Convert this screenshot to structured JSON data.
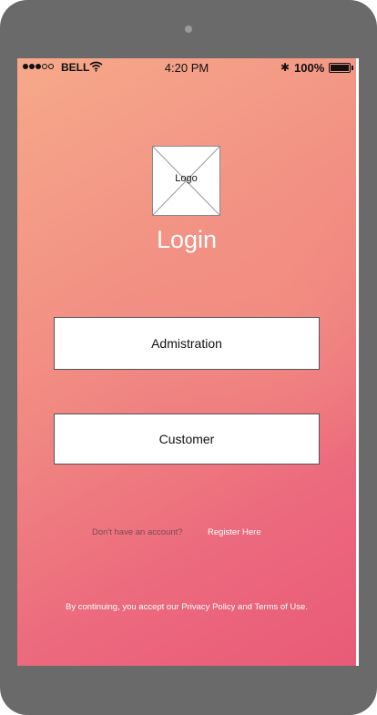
{
  "status_bar": {
    "carrier": "BELL",
    "time": "4:20 PM",
    "battery": "100%",
    "bluetooth_icon": "✱",
    "signal_bars_filled": 3,
    "signal_bars_total": 5
  },
  "logo": {
    "label": "Logo"
  },
  "title": "Login",
  "buttons": {
    "admin": "Admistration",
    "customer": "Customer"
  },
  "register": {
    "prompt": "Don't have an account?",
    "link": "Register Here"
  },
  "terms": "By continuing, you accept our Privacy Policy and Terms of Use.",
  "colors": {
    "gradient_start": "#f6a98a",
    "gradient_end": "#e95a78",
    "device_frame": "#6a6a6a"
  }
}
